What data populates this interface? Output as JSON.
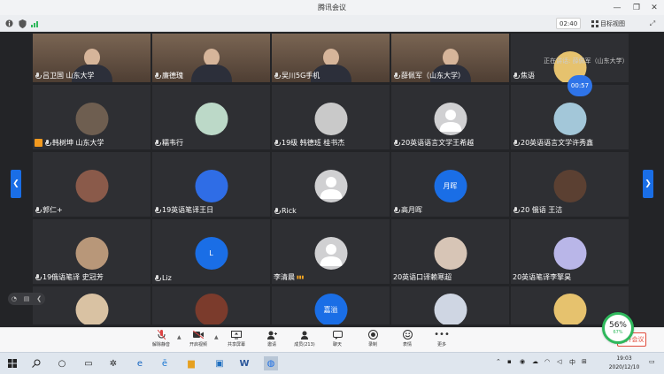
{
  "window": {
    "title": "腾讯会议",
    "controls": [
      "minimize",
      "restore",
      "close"
    ]
  },
  "topbar": {
    "meeting_time": "02:40",
    "view_label": "目标视图",
    "left_icons": [
      "info-icon",
      "shield-icon",
      "signal-icon"
    ]
  },
  "speaking_notice": "正在讲话: 薛佩军（山东大学）",
  "timer_bubble": "00:57",
  "left_float": {
    "items": [
      "headset-icon",
      "chat-icon",
      "collapse-icon"
    ]
  },
  "tiles": [
    {
      "id": "t1",
      "name": "吕卫国 山东大学",
      "kind": "video",
      "mic": true
    },
    {
      "id": "t2",
      "name": "廉德瑰",
      "kind": "video",
      "mic": true
    },
    {
      "id": "t3",
      "name": "吴川5G手机",
      "kind": "video",
      "mic": true
    },
    {
      "id": "t4",
      "name": "薛佩军（山东大学）",
      "kind": "video",
      "mic": true,
      "active": true
    },
    {
      "id": "t5",
      "name": "焦语",
      "kind": "avatar",
      "mic": true
    },
    {
      "id": "t6",
      "name": "韩树坤 山东大学",
      "kind": "avatar",
      "mic": true,
      "org": true
    },
    {
      "id": "t7",
      "name": "糯韦行",
      "kind": "avatar",
      "mic": true
    },
    {
      "id": "t8",
      "name": "19级 韩德班 桂书杰",
      "kind": "avatar",
      "mic": true
    },
    {
      "id": "t9",
      "name": "20英语语言文学王希越",
      "kind": "default",
      "mic": true
    },
    {
      "id": "t10",
      "name": "20英语语言文学许秀鑫",
      "kind": "avatar",
      "mic": true
    },
    {
      "id": "t11",
      "name": "郭仁+",
      "kind": "avatar",
      "mic": true
    },
    {
      "id": "t12",
      "name": "19英语笔译王日",
      "kind": "avatar",
      "mic": true
    },
    {
      "id": "t13",
      "name": "Rick",
      "kind": "default",
      "mic": true
    },
    {
      "id": "t14",
      "name": "高月晖",
      "kind": "text",
      "avatar_text": "月晖",
      "mic": true
    },
    {
      "id": "t15",
      "name": "20 俄语 王洁",
      "kind": "avatar",
      "mic": true
    },
    {
      "id": "t16",
      "name": "19俄语笔译 史冠芳",
      "kind": "avatar",
      "mic": true
    },
    {
      "id": "t17",
      "name": "Liz",
      "kind": "text",
      "avatar_text": "L",
      "mic": true
    },
    {
      "id": "t18",
      "name": "李清晨",
      "kind": "default",
      "mic": false,
      "signal": true
    },
    {
      "id": "t19",
      "name": "20英语口译赖寒超",
      "kind": "avatar",
      "mic": false
    },
    {
      "id": "t20",
      "name": "20英语笔译李擎昊",
      "kind": "avatar",
      "mic": false
    },
    {
      "id": "t21",
      "name": "",
      "kind": "avatar",
      "mic": false
    },
    {
      "id": "t22",
      "name": "",
      "kind": "avatar",
      "mic": false
    },
    {
      "id": "t23",
      "name": "",
      "kind": "text",
      "avatar_text": "嘉溢",
      "mic": false
    },
    {
      "id": "t24",
      "name": "",
      "kind": "avatar",
      "mic": false
    },
    {
      "id": "t25",
      "name": "",
      "kind": "avatar",
      "mic": false
    }
  ],
  "controls": {
    "mute": "解除静音",
    "video": "开启视频",
    "share": "共享屏幕",
    "invite": "邀请",
    "members": "成员(213)",
    "chat": "聊天",
    "record": "录制",
    "react": "表情",
    "more": "更多",
    "leave": "离开会议"
  },
  "network": {
    "percent": "56%",
    "sub": "67%"
  },
  "taskbar": {
    "apps": [
      "windows-icon",
      "search-icon",
      "taskview-icon",
      "pinwheel-icon",
      "edge-icon",
      "ie-icon",
      "explorer-icon",
      "word-icon",
      "tencent-meeting-icon"
    ],
    "tray_lang": "中",
    "time": "19:03",
    "date": "2020/12/10"
  },
  "colors": {
    "accent": "#1a6ee6",
    "active_border": "#2fb85c",
    "leave": "#e04a3a"
  }
}
